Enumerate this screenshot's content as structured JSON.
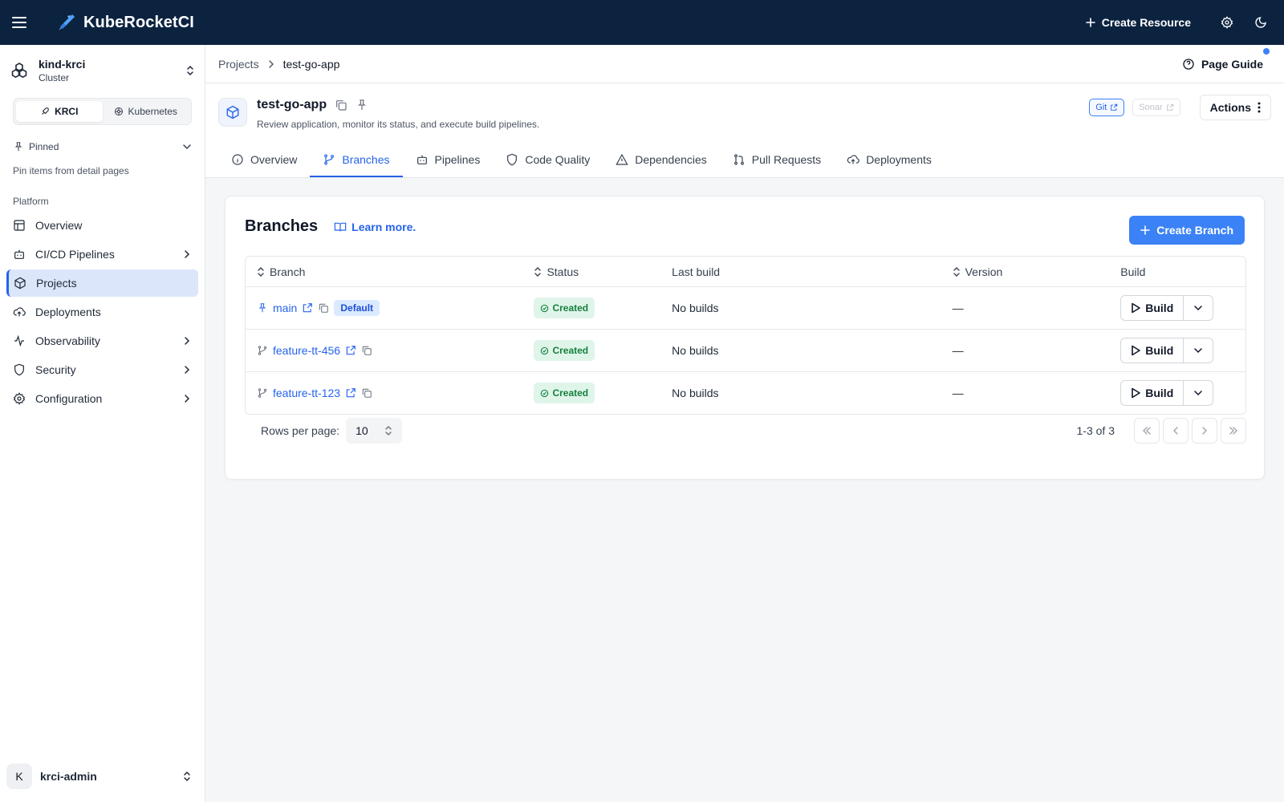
{
  "app": {
    "name": "KubeRocketCI"
  },
  "topbar": {
    "create_resource": "Create Resource"
  },
  "cluster": {
    "name": "kind-krci",
    "type": "Cluster"
  },
  "mode_switch": {
    "krci": "KRCI",
    "kubernetes": "Kubernetes"
  },
  "pinned": {
    "label": "Pinned",
    "hint": "Pin items from detail pages"
  },
  "sidebar": {
    "section": "Platform",
    "items": [
      {
        "label": "Overview"
      },
      {
        "label": "CI/CD Pipelines"
      },
      {
        "label": "Projects"
      },
      {
        "label": "Deployments"
      },
      {
        "label": "Observability"
      },
      {
        "label": "Security"
      },
      {
        "label": "Configuration"
      }
    ]
  },
  "user": {
    "initial": "K",
    "name": "krci-admin"
  },
  "breadcrumb": {
    "parent": "Projects",
    "current": "test-go-app"
  },
  "page_guide": "Page Guide",
  "project": {
    "name": "test-go-app",
    "description": "Review application, monitor its status, and execute build pipelines.",
    "git_link": "Git",
    "sonar_link": "Sonar",
    "actions": "Actions"
  },
  "tabs": [
    {
      "label": "Overview"
    },
    {
      "label": "Branches"
    },
    {
      "label": "Pipelines"
    },
    {
      "label": "Code Quality"
    },
    {
      "label": "Dependencies"
    },
    {
      "label": "Pull Requests"
    },
    {
      "label": "Deployments"
    }
  ],
  "branches": {
    "title": "Branches",
    "learn_more": "Learn more.",
    "create_button": "Create Branch",
    "columns": {
      "branch": "Branch",
      "status": "Status",
      "last_build": "Last build",
      "version": "Version",
      "build": "Build"
    },
    "rows": [
      {
        "name": "main",
        "default_badge": "Default",
        "status": "Created",
        "last_build": "No builds",
        "version": "—",
        "build": "Build"
      },
      {
        "name": "feature-tt-456",
        "status": "Created",
        "last_build": "No builds",
        "version": "—",
        "build": "Build"
      },
      {
        "name": "feature-tt-123",
        "status": "Created",
        "last_build": "No builds",
        "version": "—",
        "build": "Build"
      }
    ],
    "pagination": {
      "rows_per_page_label": "Rows per page:",
      "rows_per_page": "10",
      "range": "1-3 of 3"
    }
  },
  "colors": {
    "topbar": "#0c2340",
    "accent": "#3b82f6",
    "link": "#2563eb",
    "status_created": "#15803d"
  }
}
